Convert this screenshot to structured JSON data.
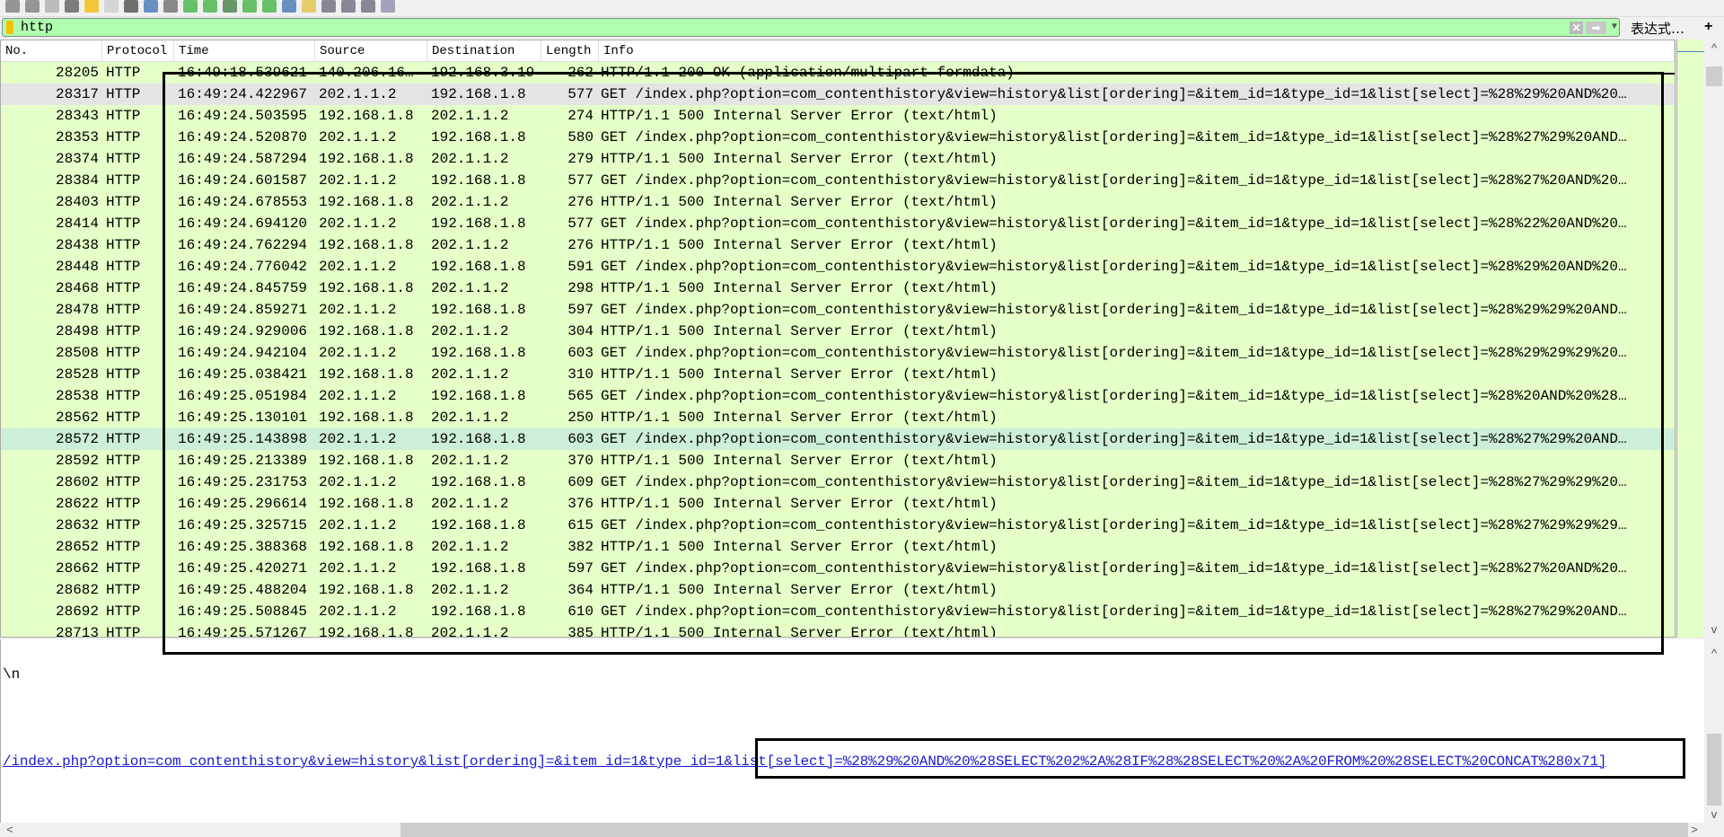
{
  "toolbar": {
    "icons": [
      "shark-fin-start-icon",
      "stop-icon",
      "restart-icon",
      "options-icon",
      "open-icon",
      "file-icon",
      "close-file-icon",
      "reload-icon",
      "find-icon",
      "back-icon",
      "forward-icon",
      "goto-icon",
      "first-icon",
      "last-icon",
      "autoscroll-icon",
      "colorize-icon",
      "zoom-in-icon",
      "zoom-out-icon",
      "zoom-normal-icon",
      "resize-columns-icon"
    ]
  },
  "filter": {
    "value": "http",
    "expression_label": "表达式…",
    "plus_label": "+",
    "clear_icon": "clear-icon",
    "apply_icon": "apply-arrow-icon"
  },
  "columns": [
    "No.",
    "Protocol",
    "Time",
    "Source",
    "Destination",
    "Length",
    "Info"
  ],
  "rows": [
    [
      "28205",
      "HTTP",
      "16:49:18.539621",
      "140.206.16…",
      "192.168.3.19",
      "262",
      "HTTP/1.1 200 OK  (application/multipart-formdata)"
    ],
    [
      "28317",
      "HTTP",
      "16:49:24.422967",
      "202.1.1.2",
      "192.168.1.8",
      "577",
      "GET /index.php?option=com_contenthistory&view=history&list[ordering]=&item_id=1&type_id=1&list[select]=%28%29%20AND%20…"
    ],
    [
      "28343",
      "HTTP",
      "16:49:24.503595",
      "192.168.1.8",
      "202.1.1.2",
      "274",
      "HTTP/1.1 500 Internal Server Error  (text/html)"
    ],
    [
      "28353",
      "HTTP",
      "16:49:24.520870",
      "202.1.1.2",
      "192.168.1.8",
      "580",
      "GET /index.php?option=com_contenthistory&view=history&list[ordering]=&item_id=1&type_id=1&list[select]=%28%27%29%20AND…"
    ],
    [
      "28374",
      "HTTP",
      "16:49:24.587294",
      "192.168.1.8",
      "202.1.1.2",
      "279",
      "HTTP/1.1 500 Internal Server Error  (text/html)"
    ],
    [
      "28384",
      "HTTP",
      "16:49:24.601587",
      "202.1.1.2",
      "192.168.1.8",
      "577",
      "GET /index.php?option=com_contenthistory&view=history&list[ordering]=&item_id=1&type_id=1&list[select]=%28%27%20AND%20…"
    ],
    [
      "28403",
      "HTTP",
      "16:49:24.678553",
      "192.168.1.8",
      "202.1.1.2",
      "276",
      "HTTP/1.1 500 Internal Server Error  (text/html)"
    ],
    [
      "28414",
      "HTTP",
      "16:49:24.694120",
      "202.1.1.2",
      "192.168.1.8",
      "577",
      "GET /index.php?option=com_contenthistory&view=history&list[ordering]=&item_id=1&type_id=1&list[select]=%28%22%20AND%20…"
    ],
    [
      "28438",
      "HTTP",
      "16:49:24.762294",
      "192.168.1.8",
      "202.1.1.2",
      "276",
      "HTTP/1.1 500 Internal Server Error  (text/html)"
    ],
    [
      "28448",
      "HTTP",
      "16:49:24.776042",
      "202.1.1.2",
      "192.168.1.8",
      "591",
      "GET /index.php?option=com_contenthistory&view=history&list[ordering]=&item_id=1&type_id=1&list[select]=%28%29%20AND%20…"
    ],
    [
      "28468",
      "HTTP",
      "16:49:24.845759",
      "192.168.1.8",
      "202.1.1.2",
      "298",
      "HTTP/1.1 500 Internal Server Error  (text/html)"
    ],
    [
      "28478",
      "HTTP",
      "16:49:24.859271",
      "202.1.1.2",
      "192.168.1.8",
      "597",
      "GET /index.php?option=com_contenthistory&view=history&list[ordering]=&item_id=1&type_id=1&list[select]=%28%29%29%20AND…"
    ],
    [
      "28498",
      "HTTP",
      "16:49:24.929006",
      "192.168.1.8",
      "202.1.1.2",
      "304",
      "HTTP/1.1 500 Internal Server Error  (text/html)"
    ],
    [
      "28508",
      "HTTP",
      "16:49:24.942104",
      "202.1.1.2",
      "192.168.1.8",
      "603",
      "GET /index.php?option=com_contenthistory&view=history&list[ordering]=&item_id=1&type_id=1&list[select]=%28%29%29%29%20…"
    ],
    [
      "28528",
      "HTTP",
      "16:49:25.038421",
      "192.168.1.8",
      "202.1.1.2",
      "310",
      "HTTP/1.1 500 Internal Server Error  (text/html)"
    ],
    [
      "28538",
      "HTTP",
      "16:49:25.051984",
      "202.1.1.2",
      "192.168.1.8",
      "565",
      "GET /index.php?option=com_contenthistory&view=history&list[ordering]=&item_id=1&type_id=1&list[select]=%28%20AND%20%28…"
    ],
    [
      "28562",
      "HTTP",
      "16:49:25.130101",
      "192.168.1.8",
      "202.1.1.2",
      "250",
      "HTTP/1.1 500 Internal Server Error  (text/html)"
    ],
    [
      "28572",
      "HTTP",
      "16:49:25.143898",
      "202.1.1.2",
      "192.168.1.8",
      "603",
      "GET /index.php?option=com_contenthistory&view=history&list[ordering]=&item_id=1&type_id=1&list[select]=%28%27%29%20AND…"
    ],
    [
      "28592",
      "HTTP",
      "16:49:25.213389",
      "192.168.1.8",
      "202.1.1.2",
      "370",
      "HTTP/1.1 500 Internal Server Error  (text/html)"
    ],
    [
      "28602",
      "HTTP",
      "16:49:25.231753",
      "202.1.1.2",
      "192.168.1.8",
      "609",
      "GET /index.php?option=com_contenthistory&view=history&list[ordering]=&item_id=1&type_id=1&list[select]=%28%27%29%29%20…"
    ],
    [
      "28622",
      "HTTP",
      "16:49:25.296614",
      "192.168.1.8",
      "202.1.1.2",
      "376",
      "HTTP/1.1 500 Internal Server Error  (text/html)"
    ],
    [
      "28632",
      "HTTP",
      "16:49:25.325715",
      "202.1.1.2",
      "192.168.1.8",
      "615",
      "GET /index.php?option=com_contenthistory&view=history&list[ordering]=&item_id=1&type_id=1&list[select]=%28%27%29%29%29…"
    ],
    [
      "28652",
      "HTTP",
      "16:49:25.388368",
      "192.168.1.8",
      "202.1.1.2",
      "382",
      "HTTP/1.1 500 Internal Server Error  (text/html)"
    ],
    [
      "28662",
      "HTTP",
      "16:49:25.420271",
      "202.1.1.2",
      "192.168.1.8",
      "597",
      "GET /index.php?option=com_contenthistory&view=history&list[ordering]=&item_id=1&type_id=1&list[select]=%28%27%20AND%20…"
    ],
    [
      "28682",
      "HTTP",
      "16:49:25.488204",
      "192.168.1.8",
      "202.1.1.2",
      "364",
      "HTTP/1.1 500 Internal Server Error  (text/html)"
    ],
    [
      "28692",
      "HTTP",
      "16:49:25.508845",
      "202.1.1.2",
      "192.168.1.8",
      "610",
      "GET /index.php?option=com_contenthistory&view=history&list[ordering]=&item_id=1&type_id=1&list[select]=%28%27%29%20AND…"
    ],
    [
      "28713",
      "HTTP",
      "16:49:25.571267",
      "192.168.1.8",
      "202.1.1.2",
      "385",
      "HTTP/1.1 500 Internal Server Error  (text/html)"
    ]
  ],
  "selected_row": "28317",
  "highlighted_row": "28572",
  "colors": {
    "row_bg": "#e4ffc7",
    "filter_bg": "#afffaf",
    "selected": "#e4e4e4",
    "highlight": "#cdeed8",
    "link": "#1a1ad0"
  },
  "detail": {
    "line1": "\\n",
    "request_uri": "/index.php?option=com_contenthistory&view=history&list[ordering]=&item_id=1&type_id=1&list[select]=%28%29%20AND%20%28SELECT%202%2A%28IF%28%28SELECT%20%2A%20FROM%20%28SELECT%20CONCAT%280x71]"
  }
}
